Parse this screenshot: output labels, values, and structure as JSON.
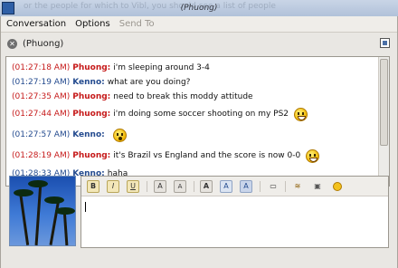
{
  "window": {
    "title": "(Phuong)",
    "ghost_text": "or the people for which to Vibl, you should see a list of people"
  },
  "menubar": {
    "conversation": "Conversation",
    "options": "Options",
    "send_to": "Send To"
  },
  "tab": {
    "name": "(Phuong)"
  },
  "messages": [
    {
      "time": "(01:27:18 AM)",
      "sender": "Phuong:",
      "text": "i'm sleeping around 3-4",
      "color": "#c61a1a",
      "smiley": ""
    },
    {
      "time": "(01:27:19 AM)",
      "sender": "Kenno:",
      "text": "what are you doing?",
      "color": "#244b8f",
      "smiley": ""
    },
    {
      "time": "(01:27:35 AM)",
      "sender": "Phuong:",
      "text": "need to break this moddy attitude",
      "color": "#c61a1a",
      "smiley": ""
    },
    {
      "time": "(01:27:44 AM)",
      "sender": "Phuong:",
      "text": "i'm doing some soccer shooting on my PS2",
      "color": "#c61a1a",
      "smiley": "grin-smiley-icon"
    },
    {
      "time": "(01:27:57 AM)",
      "sender": "Kenno:",
      "text": "",
      "color": "#244b8f",
      "smiley": "shocked-smiley-icon"
    },
    {
      "time": "(01:28:19 AM)",
      "sender": "Phuong:",
      "text": "it's Brazil vs England and the score is now 0-0",
      "color": "#c61a1a",
      "smiley": "grin-smiley-icon"
    },
    {
      "time": "(01:28:33 AM)",
      "sender": "Kenno:",
      "text": "haha",
      "color": "#244b8f",
      "smiley": ""
    }
  ],
  "toolbar": {
    "bold": "B",
    "italic": "I",
    "underline": "U",
    "font_larger": "A",
    "font_smaller": "A",
    "font_face": "A",
    "fg_color": "A",
    "bg_color": "A",
    "icons": [
      "bold-icon",
      "italic-icon",
      "underline-icon",
      "font-larger-icon",
      "font-smaller-icon",
      "font-face-icon",
      "foreground-color-icon",
      "background-color-icon",
      "reset-format-icon",
      "insert-link-icon",
      "insert-image-icon",
      "insert-smiley-icon"
    ]
  },
  "composer": {
    "value": ""
  }
}
